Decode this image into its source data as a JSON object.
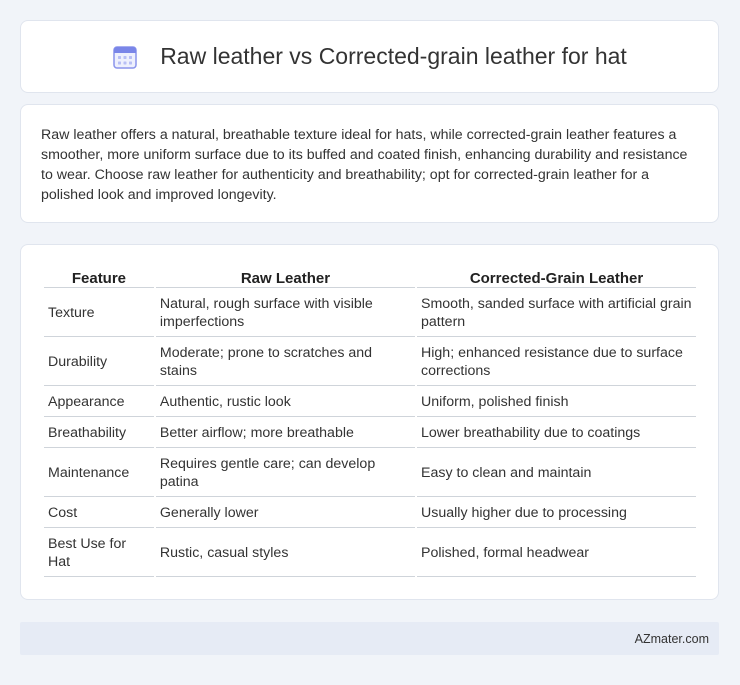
{
  "header": {
    "title": "Raw leather vs Corrected-grain leather for hat",
    "icon": "calendar-icon",
    "icon_color": "#7a86e8"
  },
  "intro": {
    "text": "Raw leather offers a natural, breathable texture ideal for hats, while corrected-grain leather features a smoother, more uniform surface due to its buffed and coated finish, enhancing durability and resistance to wear. Choose raw leather for authenticity and breathability; opt for corrected-grain leather for a polished look and improved longevity."
  },
  "table": {
    "headers": [
      "Feature",
      "Raw Leather",
      "Corrected-Grain Leather"
    ],
    "rows": [
      [
        "Texture",
        "Natural, rough surface with visible imperfections",
        "Smooth, sanded surface with artificial grain pattern"
      ],
      [
        "Durability",
        "Moderate; prone to scratches and stains",
        "High; enhanced resistance due to surface corrections"
      ],
      [
        "Appearance",
        "Authentic, rustic look",
        "Uniform, polished finish"
      ],
      [
        "Breathability",
        "Better airflow; more breathable",
        "Lower breathability due to coatings"
      ],
      [
        "Maintenance",
        "Requires gentle care; can develop patina",
        "Easy to clean and maintain"
      ],
      [
        "Cost",
        "Generally lower",
        "Usually higher due to processing"
      ],
      [
        "Best Use for Hat",
        "Rustic, casual styles",
        "Polished, formal headwear"
      ]
    ]
  },
  "footer": {
    "text": "AZmater.com"
  }
}
